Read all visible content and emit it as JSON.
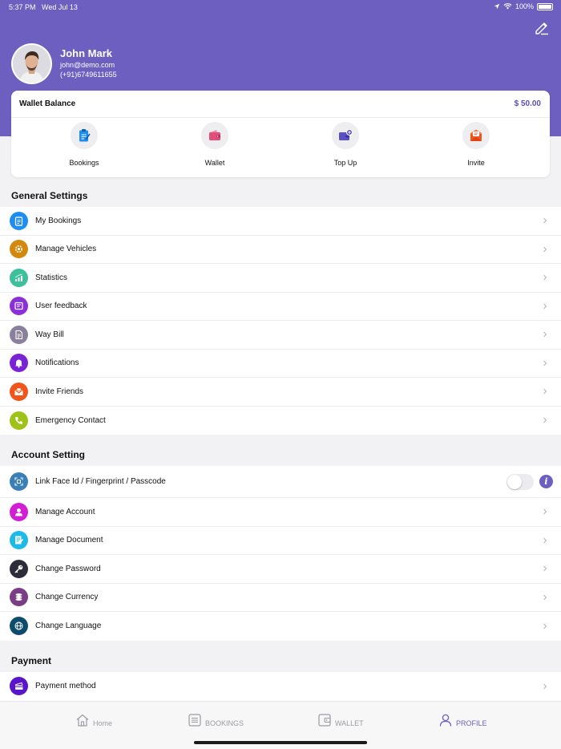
{
  "status_bar": {
    "time": "5:37 PM",
    "date": "Wed Jul 13",
    "battery": "100%"
  },
  "profile": {
    "name": "John Mark",
    "email": "john@demo.com",
    "phone": "(+91)6749611655"
  },
  "wallet_card": {
    "label": "Wallet Balance",
    "amount": "$ 50.00",
    "actions": [
      {
        "label": "Bookings",
        "icon": "bookings-icon"
      },
      {
        "label": "Wallet",
        "icon": "wallet-icon"
      },
      {
        "label": "Top Up",
        "icon": "top-up-icon"
      },
      {
        "label": "Invite",
        "icon": "invite-icon"
      }
    ]
  },
  "general_settings": {
    "title": "General Settings",
    "items": [
      {
        "label": "My Bookings",
        "icon": "clipboard-icon",
        "color": "#1b8ef0"
      },
      {
        "label": "Manage Vehicles",
        "icon": "gear-icon",
        "color": "#d3880e"
      },
      {
        "label": "Statistics",
        "icon": "chart-icon",
        "color": "#3cc19a"
      },
      {
        "label": "User feedback",
        "icon": "feedback-icon",
        "color": "#8b2fd9"
      },
      {
        "label": "Way Bill",
        "icon": "document-icon",
        "color": "#8a7f9c"
      },
      {
        "label": "Notifications",
        "icon": "bell-icon",
        "color": "#7a22d6"
      },
      {
        "label": "Invite Friends",
        "icon": "envelope-icon",
        "color": "#f0551c"
      },
      {
        "label": "Emergency Contact",
        "icon": "phone-icon",
        "color": "#9fc219"
      }
    ]
  },
  "account_setting": {
    "title": "Account Setting",
    "items": [
      {
        "label": "Link Face Id / Fingerprint / Passcode",
        "icon": "face-id-icon",
        "color": "#3b7fb7"
      },
      {
        "label": "Manage Account",
        "icon": "user-icon",
        "color": "#d21fd5"
      },
      {
        "label": "Manage Document",
        "icon": "document-edit-icon",
        "color": "#1db9e8"
      },
      {
        "label": "Change Password",
        "icon": "key-icon",
        "color": "#2c2c3a"
      },
      {
        "label": "Change Currency",
        "icon": "coins-icon",
        "color": "#7b3d86"
      },
      {
        "label": "Change Language",
        "icon": "globe-icon",
        "color": "#0e4c6e"
      }
    ]
  },
  "payment": {
    "title": "Payment",
    "items": [
      {
        "label": "Payment method",
        "icon": "card-icon",
        "color": "#5a14c9"
      }
    ]
  },
  "tabbar": {
    "home": "Home",
    "bookings": "BOOKINGS",
    "wallet": "WALLET",
    "profile": "PROFILE"
  },
  "colors": {
    "brand": "#6c5fc0"
  }
}
